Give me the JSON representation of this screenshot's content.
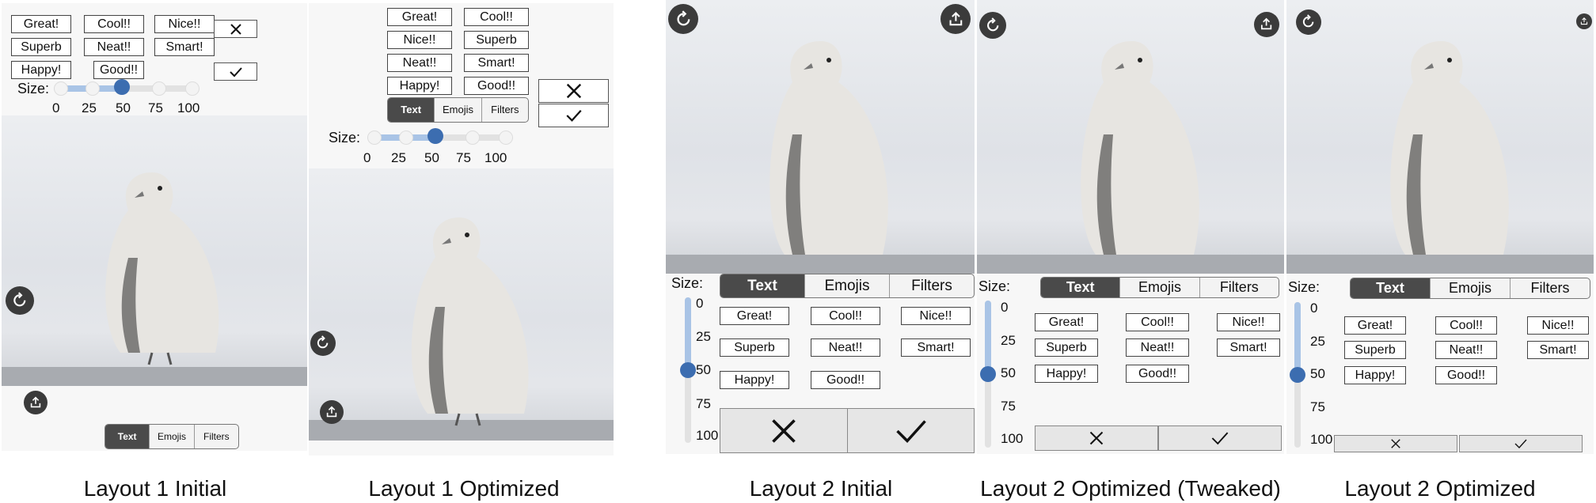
{
  "captions": {
    "l1_initial": "Layout 1 Initial",
    "l1_optimized": "Layout 1 Optimized",
    "l2_initial": "Layout 2 Initial",
    "l2_tweaked": "Layout 2 Optimized (Tweaked)",
    "l2_optimized": "Layout 2 Optimized"
  },
  "stickers": [
    "Great!",
    "Cool!!",
    "Nice!!",
    "Superb",
    "Neat!!",
    "Smart!",
    "Happy!",
    "Good!!"
  ],
  "tabs": [
    "Text",
    "Emojis",
    "Filters"
  ],
  "size_label": "Size:",
  "size_ticks": [
    "0",
    "25",
    "50",
    "75",
    "100"
  ],
  "size_value": 50,
  "colors": {
    "accent": "#3c6db0",
    "selected_tab": "#4a4a4a"
  }
}
